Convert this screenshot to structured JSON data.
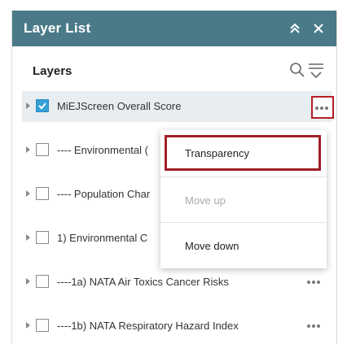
{
  "panel": {
    "title": "Layer List",
    "collapse_icon": "double-chevron-up-icon",
    "close_icon": "close-icon",
    "section_label": "Layers",
    "search_icon": "search-icon",
    "filter_icon": "filter-sort-icon",
    "header_color": "#4a7a88"
  },
  "layers": [
    {
      "name": "MiEJScreen Overall Score",
      "checked": true
    },
    {
      "name": "---- Environmental (",
      "checked": false
    },
    {
      "name": "---- Population Char",
      "checked": false
    },
    {
      "name": "1) Environmental C",
      "checked": false
    },
    {
      "name": "----1a) NATA Air Toxics Cancer Risks",
      "checked": false
    },
    {
      "name": "----1b) NATA Respiratory Hazard Index",
      "checked": false
    }
  ],
  "menu": {
    "transparency": "Transparency",
    "move_up": "Move up",
    "move_down": "Move down"
  },
  "highlight_color": "#a01f24",
  "checkbox_color": "#33a0d6"
}
